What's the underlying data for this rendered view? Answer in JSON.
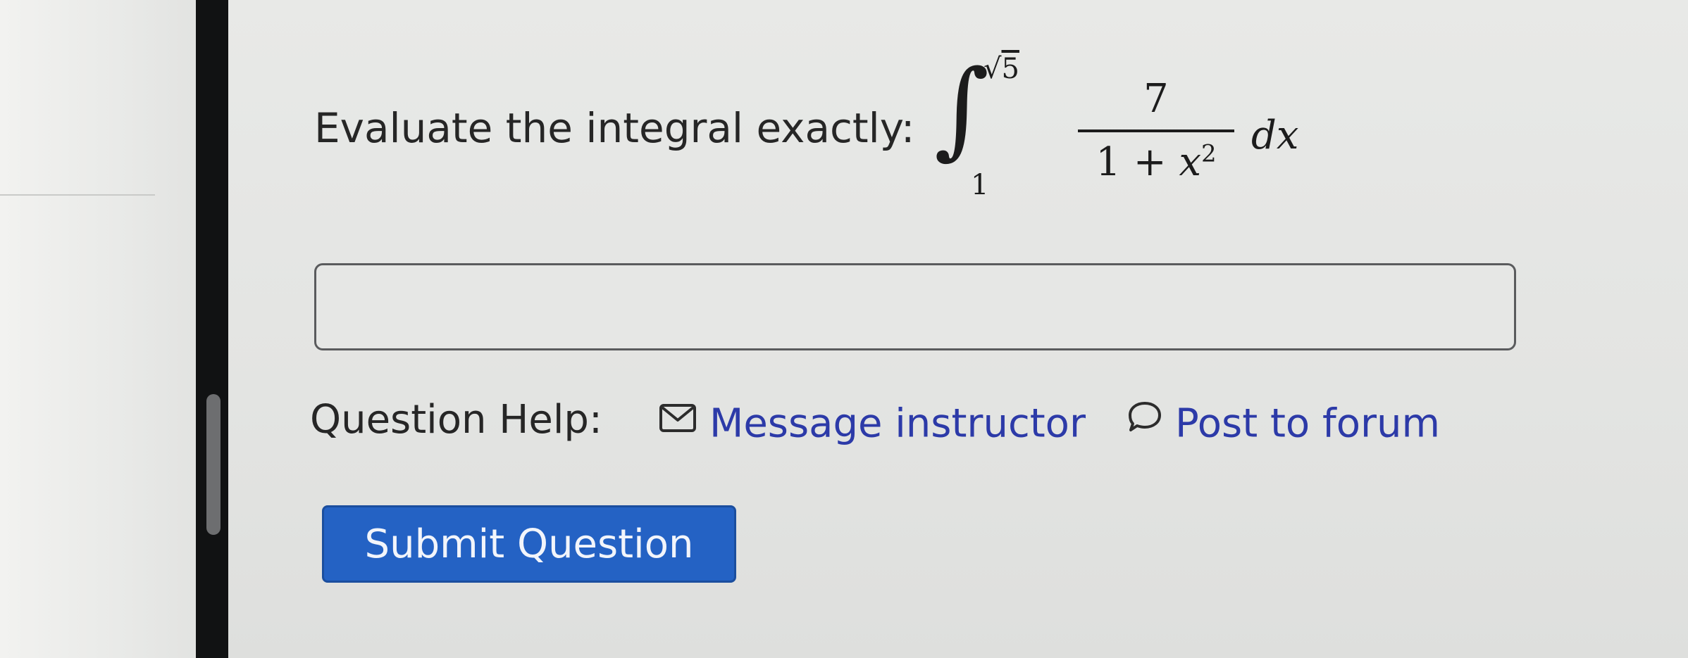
{
  "question": {
    "prompt": "Evaluate the integral exactly:",
    "integral": {
      "upper_limit_radicand": "5",
      "lower_limit": "1",
      "numerator": "7",
      "denominator_constant": "1 + ",
      "denominator_variable": "x",
      "denominator_exponent": "2",
      "differential": "dx"
    }
  },
  "answer": {
    "value": "",
    "placeholder": ""
  },
  "help": {
    "label": "Question Help:",
    "message_instructor": {
      "label": "Message instructor",
      "icon": "envelope-icon"
    },
    "post_to_forum": {
      "label": "Post to forum",
      "icon": "speech-bubble-icon"
    }
  },
  "actions": {
    "submit_label": "Submit Question"
  },
  "colors": {
    "link": "#2c3aa8",
    "submit_button": "#2462c4",
    "text": "#262626"
  }
}
